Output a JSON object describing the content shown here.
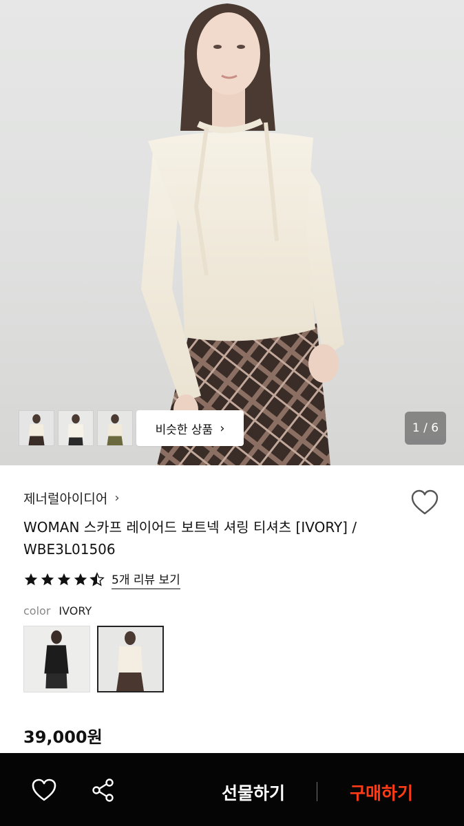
{
  "hero": {
    "pager_text": "1 / 6",
    "similar_button_label": "비슷한 상품",
    "thumbnails": [
      "thumb-1",
      "thumb-2",
      "thumb-3"
    ]
  },
  "product": {
    "brand": "제너럴아이디어",
    "title": "WOMAN 스카프 레이어드 보트넥 셔링 티셔츠 [IVORY] / WBE3L01506",
    "rating": 4.5,
    "review_link": "5개 리뷰 보기",
    "color_label": "color",
    "color_value": "IVORY",
    "price": "39,000원"
  },
  "bottom_bar": {
    "gift_label": "선물하기",
    "buy_label": "구매하기"
  },
  "colors": {
    "buy_accent": "#ff3b16",
    "bar_bg": "#050505"
  }
}
